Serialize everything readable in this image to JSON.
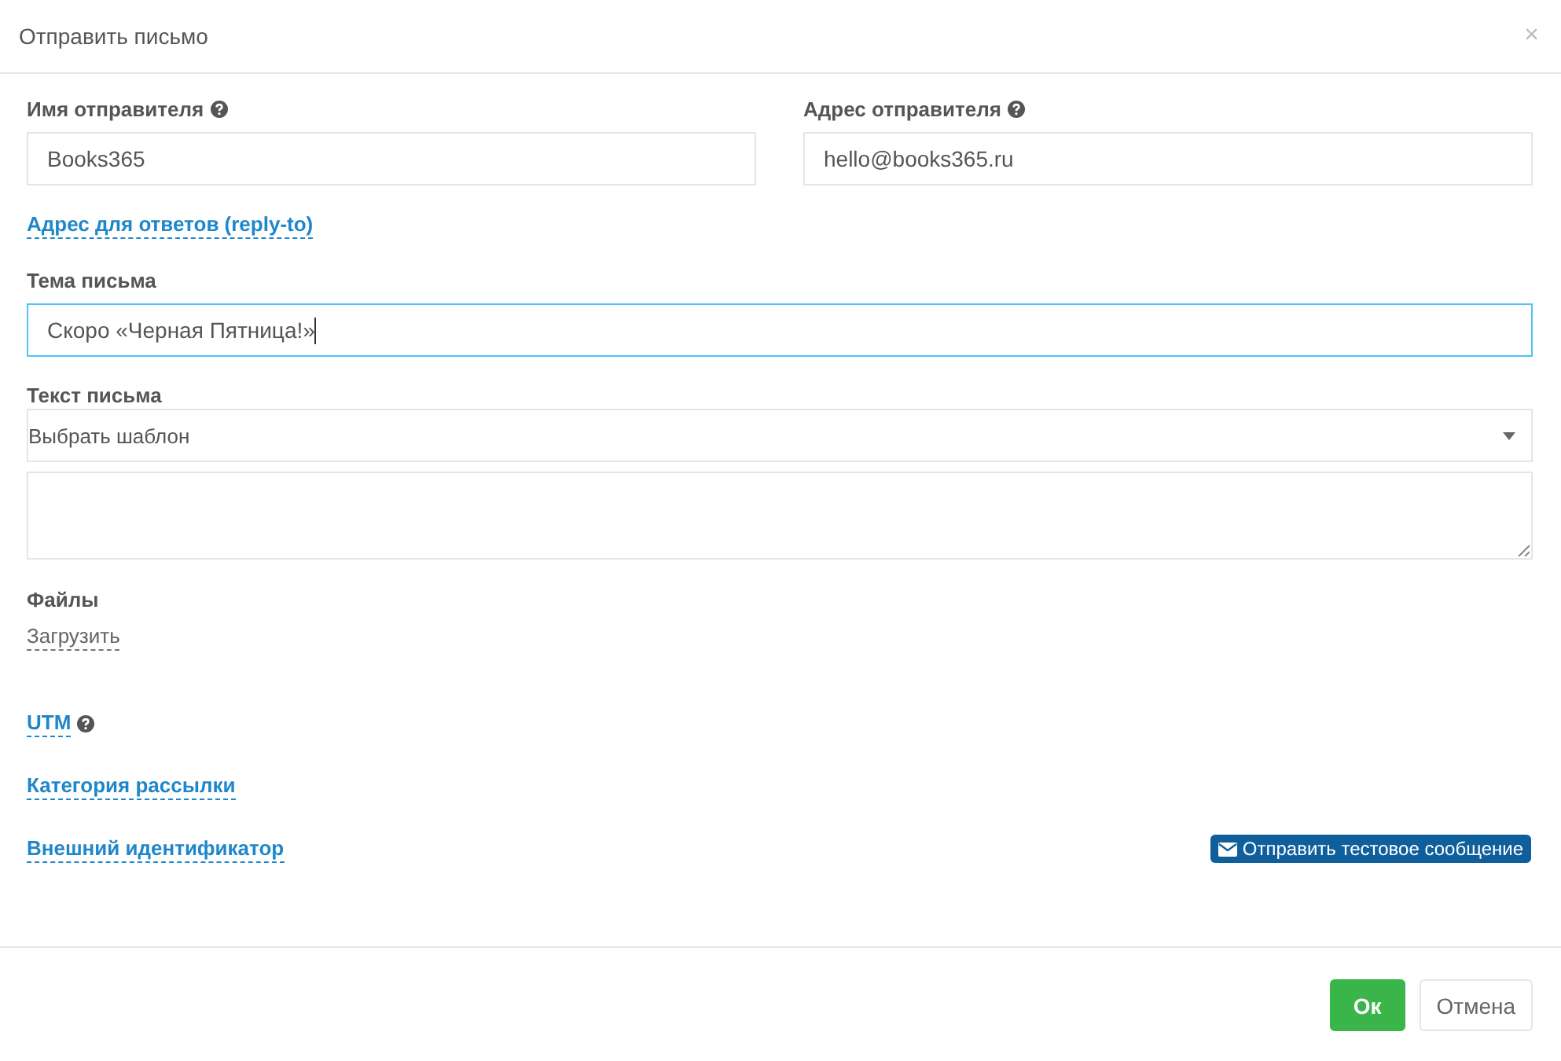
{
  "dialog": {
    "title": "Отправить письмо",
    "close": "×"
  },
  "sender_fields": [
    {
      "label": "Имя отправителя",
      "help": true,
      "value": "Books365",
      "focused": false
    },
    {
      "label": "Адрес отправителя",
      "help": true,
      "value": "hello@books365.ru",
      "focused": false
    }
  ],
  "reply_to_link": "Адрес для ответов (reply-to)",
  "subject": {
    "label": "Тема письма",
    "value": "Скоро «Черная Пятница!»",
    "focused": true
  },
  "body": {
    "label": "Текст письма",
    "template_select": "Выбрать шаблон"
  },
  "files": {
    "label": "Файлы",
    "upload_link": "Загрузить"
  },
  "option_links": [
    {
      "label": "UTM",
      "help": true
    },
    {
      "label": "Категория рассылки",
      "help": false
    },
    {
      "label": "Внешний идентификатор",
      "help": false
    }
  ],
  "test_button": "Отправить тестовое сообщение",
  "footer_buttons": [
    {
      "label": "Ок",
      "kind": "primary"
    },
    {
      "label": "Отмена",
      "kind": "default"
    }
  ]
}
